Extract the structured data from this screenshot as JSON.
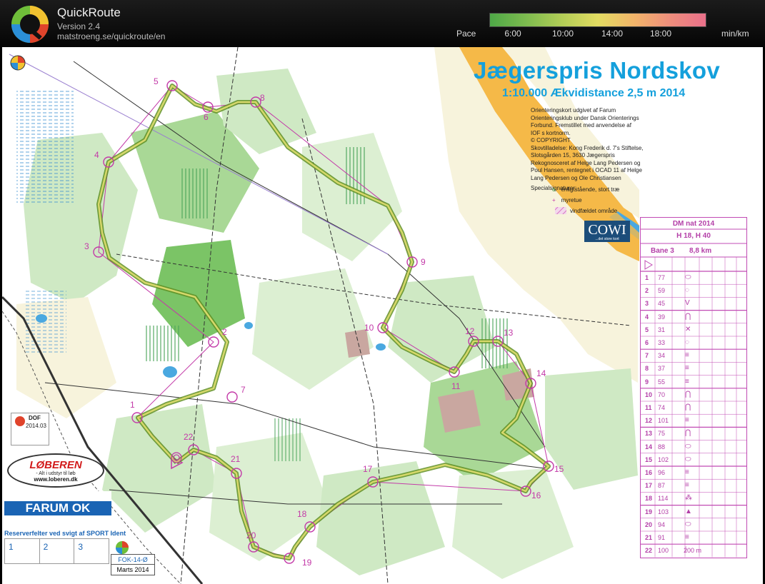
{
  "app": {
    "name": "QuickRoute",
    "version": "Version 2.4",
    "url": "matstroeng.se/quickroute/en"
  },
  "pace_scale": {
    "label": "Pace",
    "ticks": [
      "6:00",
      "10:00",
      "14:00",
      "18:00"
    ],
    "unit": "min/km",
    "colors": [
      "#4ea847",
      "#7dbb4f",
      "#b2cd56",
      "#e3dc62",
      "#f2b56a",
      "#ee8e7c",
      "#e9708a"
    ]
  },
  "map": {
    "title": "Jægerspris Nordskov",
    "scale_line": "1:10.000  Ækvidistance 2,5 m 2014",
    "credits": [
      "Orienteringskort udgivet af Farum",
      "Orienteringsklub under Dansk Orienterings",
      "Forbund. Fremstillet med anvendelse af",
      "IOF s kortnorm.",
      "© COPYRIGHT",
      "Skovtilladelse: Kong Frederik d. 7's Stiftelse,",
      "Slotsgården 15, 3630 Jægerspris",
      "Rekognosceret af Helge Lang Pedersen og",
      "Poul Hansen, rentegnet i OCAD 11 af Helge",
      "Lang Pedersen og Ole Christiansen"
    ],
    "special_symbols_heading": "Specialsignaturer:",
    "legend": [
      {
        "symbol": "o",
        "text": "énligtstående, stort træ"
      },
      {
        "symbol": "+",
        "text": "myretue"
      },
      {
        "symbol": "hatch",
        "text": "vindfældet område"
      }
    ],
    "cowi": {
      "name": "COWI",
      "tagline": "...det store kort"
    },
    "dof": {
      "label": "DOF",
      "date": "2014.03"
    },
    "loberen": {
      "name": "LØBEREN",
      "tagline": "- Alt i udstyr til løb",
      "url": "www.loberen.dk"
    },
    "club": "FARUM OK",
    "sport_ident_note": "Reserverfelter ved svigt af SPORT Ident",
    "si_boxes": [
      "1",
      "2",
      "3"
    ],
    "map_code": "FOK-14-Ø",
    "map_date": "Marts 2014"
  },
  "course": {
    "event": "DM nat 2014",
    "classes": "H 18, H 40",
    "course_name": "Bane 3",
    "length": "8,8 km",
    "bottom_note": "200 m",
    "controls": [
      {
        "n": "1",
        "code": "77"
      },
      {
        "n": "2",
        "code": "59"
      },
      {
        "n": "3",
        "code": "45"
      },
      {
        "n": "4",
        "code": "39"
      },
      {
        "n": "5",
        "code": "31"
      },
      {
        "n": "6",
        "code": "33"
      },
      {
        "n": "7",
        "code": "34"
      },
      {
        "n": "8",
        "code": "37"
      },
      {
        "n": "9",
        "code": "55"
      },
      {
        "n": "10",
        "code": "70"
      },
      {
        "n": "11",
        "code": "74"
      },
      {
        "n": "12",
        "code": "101"
      },
      {
        "n": "13",
        "code": "75"
      },
      {
        "n": "14",
        "code": "88"
      },
      {
        "n": "15",
        "code": "102"
      },
      {
        "n": "16",
        "code": "96"
      },
      {
        "n": "17",
        "code": "87"
      },
      {
        "n": "18",
        "code": "114"
      },
      {
        "n": "19",
        "code": "103"
      },
      {
        "n": "20",
        "code": "94"
      },
      {
        "n": "21",
        "code": "91"
      },
      {
        "n": "22",
        "code": "100"
      }
    ],
    "map_labels": [
      "1",
      "2",
      "3",
      "4",
      "5",
      "6",
      "7",
      "8",
      "9",
      "10",
      "11",
      "12",
      "13",
      "14",
      "15",
      "16",
      "17",
      "18",
      "19",
      "20",
      "21",
      "22"
    ]
  }
}
